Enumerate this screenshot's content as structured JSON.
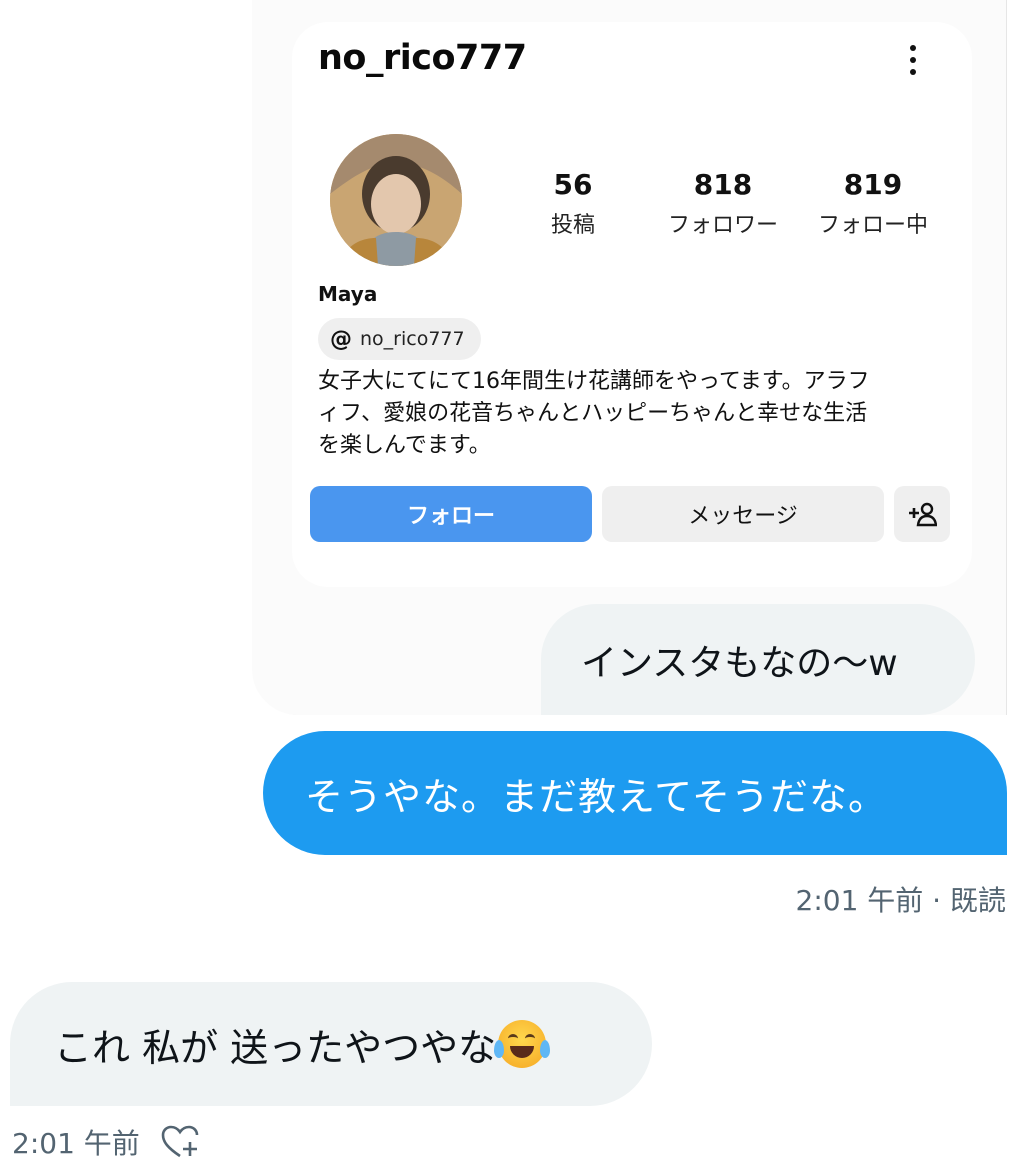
{
  "shared_image": {
    "username": "no_rico777",
    "stats": [
      {
        "value": "56",
        "label": "投稿"
      },
      {
        "value": "818",
        "label": "フォロワー"
      },
      {
        "value": "819",
        "label": "フォロー中"
      }
    ],
    "full_name": "Maya",
    "threads_handle": "no_rico777",
    "bio_lines": [
      "女子大にてにて16年間生け花講師をやってます。アラフ",
      "ィフ、愛娘の花音ちゃんとハッピーちゃんと幸せな生活",
      "を楽しんでます。"
    ],
    "follow_label": "フォロー",
    "message_label": "メッセージ",
    "add_user_icon": "add-user-icon",
    "accent": "#4a96ef"
  },
  "messages": [
    {
      "direction": "in",
      "text": "インスタもなの〜w"
    },
    {
      "direction": "out",
      "text": "そうやな。まだ教えてそうだな。",
      "time": "2:01 午前",
      "status": "既読"
    },
    {
      "direction": "in",
      "text": "これ 私が 送ったやつやな",
      "time": "2:01 午前"
    }
  ],
  "separator": " · ",
  "colors": {
    "out_bubble": "#1d9bf0",
    "in_bubble": "#eff3f4",
    "meta": "#536471"
  }
}
